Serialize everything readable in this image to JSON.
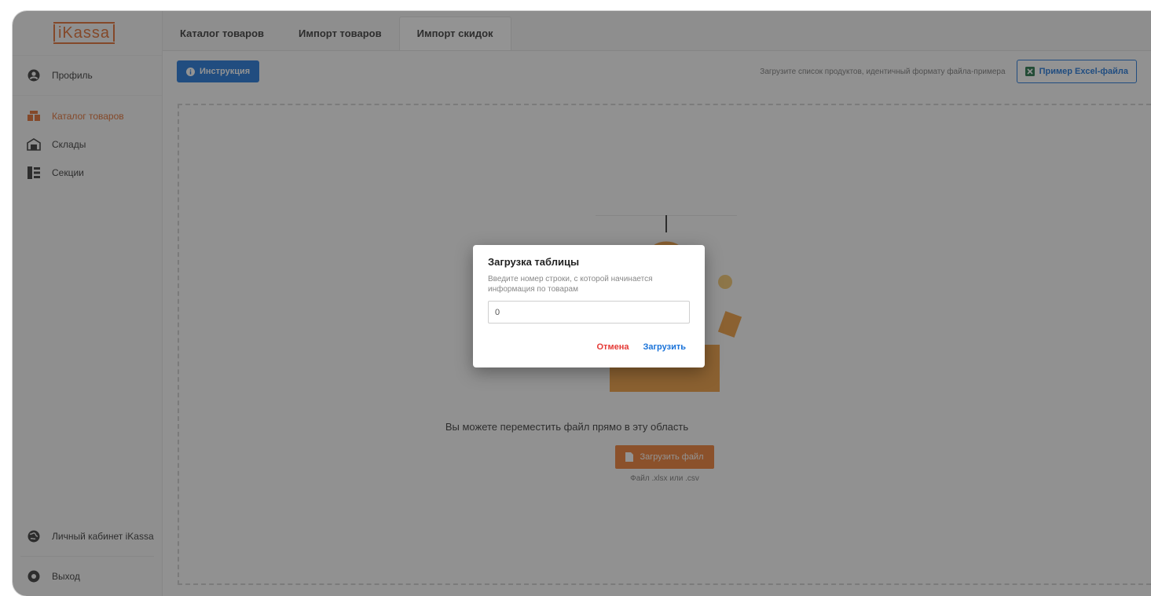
{
  "app": {
    "logo": "iKassa"
  },
  "sidebar": {
    "profile": "Профиль",
    "items": [
      {
        "label": "Каталог товаров",
        "icon": "catalog-icon",
        "active": true
      },
      {
        "label": "Склады",
        "icon": "warehouse-icon",
        "active": false
      },
      {
        "label": "Секции",
        "icon": "sections-icon",
        "active": false
      }
    ],
    "cabinet": "Личный кабинет iKassa",
    "logout": "Выход"
  },
  "tabs": [
    {
      "label": "Каталог товаров",
      "active": false
    },
    {
      "label": "Импорт товаров",
      "active": false
    },
    {
      "label": "Импорт скидок",
      "active": true
    }
  ],
  "toolbar": {
    "instruction_label": "Инструкция",
    "hint": "Загрузите список продуктов, идентичный формату файла-примера",
    "excel_label": "Пример Excel-файла"
  },
  "dropzone": {
    "text": "Вы можете переместить файл прямо в эту область",
    "upload_label": "Загрузить файл",
    "file_hint": "Файл .xlsx или .csv"
  },
  "modal": {
    "title": "Загрузка таблицы",
    "description": "Введите номер строки, с которой начинается информация по товарам",
    "input_value": "0",
    "cancel_label": "Отмена",
    "submit_label": "Загрузить"
  },
  "colors": {
    "accent": "#e0692a",
    "primary": "#1a73d9",
    "danger": "#e53935",
    "upload_button": "#ef7a2e",
    "excel_icon": "#1e7145"
  }
}
